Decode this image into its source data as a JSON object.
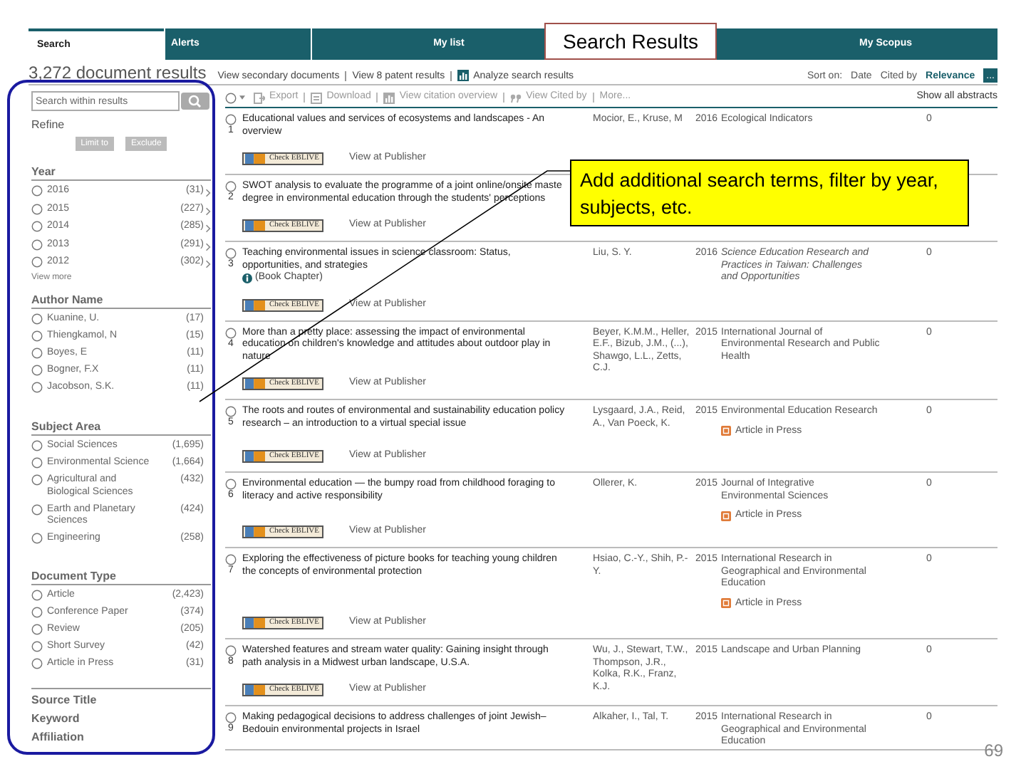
{
  "slide_title": "Search Results",
  "nav_tabs": [
    {
      "label": "Search",
      "selected": true
    },
    {
      "label": "Alerts",
      "selected": false
    },
    {
      "label": "My list",
      "selected": false
    },
    {
      "label": "My Scopus",
      "selected": false
    }
  ],
  "results_count": "3,272 document results",
  "header_links": [
    "View secondary documents",
    "View 8 patent results",
    "Analyze search results"
  ],
  "sort": {
    "label": "Sort on:",
    "options": [
      {
        "label": "Date",
        "selected": false
      },
      {
        "label": "Cited by",
        "selected": false
      },
      {
        "label": "Relevance",
        "selected": true
      }
    ],
    "more": "..."
  },
  "sidebar": {
    "search": {
      "placeholder": "Search within results"
    },
    "refine": "Refine",
    "buttons": [
      "Limit to",
      "Exclude"
    ],
    "facets": [
      {
        "title": "Year",
        "chevrons": true,
        "items": [
          {
            "label": "2016",
            "count": "(31)",
            "checked": false
          },
          {
            "label": "2015",
            "count": "(227)",
            "checked": false
          },
          {
            "label": "2014",
            "count": "(285)",
            "checked": false
          },
          {
            "label": "2013",
            "count": "(291)",
            "checked": false
          },
          {
            "label": "2012",
            "count": "(302)",
            "checked": false
          }
        ],
        "more": "View more"
      },
      {
        "title": "Author Name",
        "chevrons": false,
        "items": [
          {
            "label": "Kuanine, U.",
            "count": "(17)",
            "checked": false
          },
          {
            "label": "Thiengkamol, N",
            "count": "(15)",
            "checked": false
          },
          {
            "label": "Boyes, E",
            "count": "(11)",
            "checked": false
          },
          {
            "label": "Bogner, F.X",
            "count": "(11)",
            "checked": false
          },
          {
            "label": "Jacobson, S.K.",
            "count": "(11)",
            "checked": false
          }
        ]
      },
      {
        "title": "Subject Area",
        "chevrons": false,
        "items": [
          {
            "label": "Social Sciences",
            "count": "(1,695)",
            "checked": false
          },
          {
            "label": "Environmental Science",
            "count": "(1,664)",
            "checked": false
          },
          {
            "label": "Agricultural and Biological Sciences",
            "count": "(432)",
            "checked": false
          },
          {
            "label": "Earth and Planetary Sciences",
            "count": "(424)",
            "checked": false
          },
          {
            "label": "Engineering",
            "count": "(258)",
            "checked": false
          }
        ]
      },
      {
        "title": "Document Type",
        "chevrons": false,
        "items": [
          {
            "label": "Article",
            "count": "(2,423)",
            "checked": false
          },
          {
            "label": "Conference Paper",
            "count": "(374)",
            "checked": false
          },
          {
            "label": "Review",
            "count": "(205)",
            "checked": false
          },
          {
            "label": "Short Survey",
            "count": "(42)",
            "checked": false
          },
          {
            "label": "Article in Press",
            "count": "(31)",
            "checked": false
          }
        ]
      }
    ],
    "collapsed_facets": [
      "Source Title",
      "Keyword",
      "Affiliation"
    ]
  },
  "toolbar": {
    "select_all_checked": false,
    "actions": [
      "Export",
      "Download",
      "View citation overview",
      "View Cited by",
      "More..."
    ],
    "show_abstracts": "Show all abstracts"
  },
  "results": [
    {
      "number": "1",
      "checked": false,
      "title": "Educational values and services of ecosystems and landscapes - An overview",
      "authors": "Mocior, E., Kruse, M",
      "year": "2016",
      "source": "Ecological Indicators",
      "source_italic": false,
      "cited": "0",
      "check_button": "Check EBLIVE",
      "publisher_link": "View at Publisher"
    },
    {
      "number": "2",
      "checked": false,
      "title": "SWOT analysis to evaluate the programme of a joint online/onsite maste degree in environmental education through the students' perceptions",
      "check_button": "Check EBLIVE",
      "publisher_link": "View at Publisher"
    },
    {
      "number": "3",
      "checked": false,
      "title": "Teaching environmental issues in science classroom: Status, opportunities, and strategies",
      "badge": "(Book Chapter)",
      "authors": "Liu, S. Y.",
      "year": "2016",
      "source": "Science Education Research and Practices in Taiwan: Challenges and Opportunities",
      "source_italic": true,
      "cited": "0",
      "check_button": "Check EBLIVE",
      "publisher_link": "View at Publisher"
    },
    {
      "number": "4",
      "checked": false,
      "title": "More than a pretty place: assessing the impact of environmental education on children's knowledge and attitudes about outdoor play in nature",
      "authors": "Beyer, K.M.M., Heller, E.F., Bizub, J.M., (...), Shawgo, L.L., Zetts, C.J.",
      "year": "2015",
      "source": "International Journal of Environmental Research and Public Health",
      "source_italic": false,
      "cited": "0",
      "check_button": "Check EBLIVE",
      "publisher_link": "View at Publisher"
    },
    {
      "number": "5",
      "checked": false,
      "title": "The roots and routes of environmental and sustainability education policy research – an introduction to a virtual special issue",
      "authors": "Lysgaard, J.A., Reid, A., Van Poeck, K.",
      "year": "2015",
      "source": "Environmental Education Research",
      "source_italic": false,
      "in_press": "Article in Press",
      "cited": "0",
      "check_button": "Check EBLIVE",
      "publisher_link": "View at Publisher"
    },
    {
      "number": "6",
      "checked": false,
      "title": "Environmental education — the bumpy road from childhood foraging to literacy and active responsibility",
      "authors": "Ollerer, K.",
      "year": "2015",
      "source": "Journal of Integrative Environmental Sciences",
      "source_italic": false,
      "in_press": "Article in Press",
      "cited": "0",
      "check_button": "Check EBLIVE",
      "publisher_link": "View at Publisher"
    },
    {
      "number": "7",
      "checked": false,
      "title": "Exploring the effectiveness of picture books for teaching young children the concepts of environmental protection",
      "authors": "Hsiao, C.-Y., Shih, P.-Y.",
      "year": "2015",
      "source": "International Research in Geographical and Environmental Education",
      "source_italic": false,
      "in_press": "Article in Press",
      "cited": "0",
      "check_button": "Check EBLIVE",
      "publisher_link": "View at Publisher"
    },
    {
      "number": "8",
      "checked": false,
      "title": "Watershed features and stream water quality: Gaining insight through path analysis in a Midwest urban landscape, U.S.A.",
      "authors": "Wu, J., Stewart, T.W., Thompson, J.R., Kolka, R.K., Franz, K.J.",
      "year": "2015",
      "source": "Landscape and Urban Planning",
      "source_italic": false,
      "cited": "0",
      "check_button": "Check EBLIVE",
      "publisher_link": "View at Publisher"
    },
    {
      "number": "9",
      "checked": false,
      "title": "Making pedagogical decisions to address challenges of joint Jewish–Bedouin environmental projects in Israel",
      "authors": "Alkaher, I., Tal, T.",
      "year": "2015",
      "source": "International Research in Geographical and Environmental Education",
      "source_italic": false,
      "cited": "0"
    }
  ],
  "callout": "Add additional search terms, filter by year, subjects, etc.",
  "page_number": "69"
}
